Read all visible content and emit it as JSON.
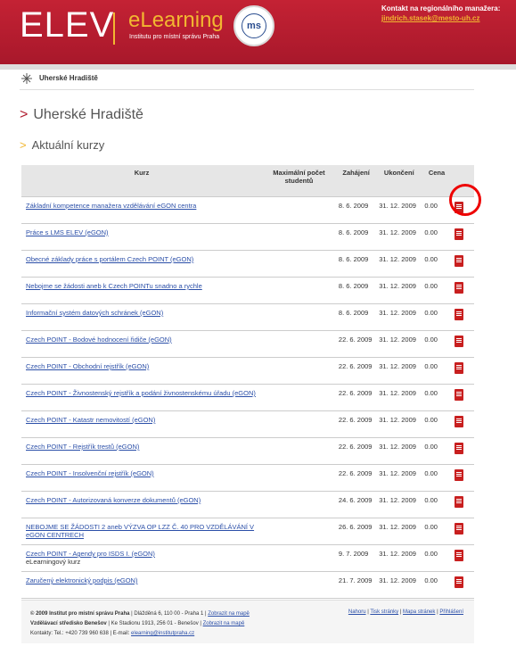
{
  "header": {
    "brand": "ELEV",
    "product": "eLearning",
    "subtitle": "Institutu pro místní správu Praha",
    "contact_label": "Kontakt na regionálního manažera:",
    "contact_email": "jindrich.stasek@mesto-uh.cz"
  },
  "breadcrumb": {
    "label": "Uherské Hradiště"
  },
  "page": {
    "title": "Uherské Hradiště",
    "section": "Aktuální kurzy"
  },
  "table": {
    "headers": {
      "course": "Kurz",
      "max": "Maximální počet studentů",
      "start": "Zahájení",
      "end": "Ukončení",
      "price": "Cena"
    },
    "rows": [
      {
        "name": "Základní kompetence manažera vzdělávání eGON centra",
        "note": "",
        "start": "8. 6. 2009",
        "end": "31. 12. 2009",
        "price": "0.00"
      },
      {
        "name": "Práce s LMS ELEV (eGON)",
        "note": "",
        "start": "8. 6. 2009",
        "end": "31. 12. 2009",
        "price": "0.00"
      },
      {
        "name": "Obecné základy práce s portálem Czech POINT (eGON)",
        "note": "",
        "start": "8. 6. 2009",
        "end": "31. 12. 2009",
        "price": "0.00"
      },
      {
        "name": "Nebojme se žádosti aneb k Czech POINTu snadno a rychle",
        "note": "",
        "start": "8. 6. 2009",
        "end": "31. 12. 2009",
        "price": "0.00"
      },
      {
        "name": "Informační systém datových schránek (eGON)",
        "note": "",
        "start": "8. 6. 2009",
        "end": "31. 12. 2009",
        "price": "0.00"
      },
      {
        "name": "Czech POINT - Bodové hodnocení řidiče (eGON)",
        "note": "",
        "start": "22. 6. 2009",
        "end": "31. 12. 2009",
        "price": "0.00"
      },
      {
        "name": "Czech POINT - Obchodní rejstřík (eGON)",
        "note": "",
        "start": "22. 6. 2009",
        "end": "31. 12. 2009",
        "price": "0.00"
      },
      {
        "name": "Czech POINT - Živnostenský rejstřík a podání živnostenskému úřadu (eGON)",
        "note": "",
        "start": "22. 6. 2009",
        "end": "31. 12. 2009",
        "price": "0.00"
      },
      {
        "name": "Czech POINT - Katastr nemovitostí (eGON)",
        "note": "",
        "start": "22. 6. 2009",
        "end": "31. 12. 2009",
        "price": "0.00"
      },
      {
        "name": "Czech POINT - Rejstřík trestů (eGON)",
        "note": "",
        "start": "22. 6. 2009",
        "end": "31. 12. 2009",
        "price": "0.00"
      },
      {
        "name": "Czech POINT - Insolvenční rejstřík (eGON)",
        "note": "",
        "start": "22. 6. 2009",
        "end": "31. 12. 2009",
        "price": "0.00"
      },
      {
        "name": "Czech POINT - Autorizovaná konverze dokumentů (eGON)",
        "note": "",
        "start": "24. 6. 2009",
        "end": "31. 12. 2009",
        "price": "0.00"
      },
      {
        "name": "NEBOJME SE ŽÁDOSTI 2 aneb VÝZVA OP LZZ Č. 40 PRO VZDĚLÁVÁNÍ V eGON CENTRECH",
        "note": "",
        "start": "26. 6. 2009",
        "end": "31. 12. 2009",
        "price": "0.00"
      },
      {
        "name": "Czech POINT - Agendy pro ISDS I. (eGON)",
        "note": "eLearningový kurz",
        "start": "9. 7. 2009",
        "end": "31. 12. 2009",
        "price": "0.00"
      },
      {
        "name": "Zaručený elektronický podpis (eGON)",
        "note": "",
        "start": "21. 7. 2009",
        "end": "31. 12. 2009",
        "price": "0.00"
      }
    ]
  },
  "footer": {
    "copyright": "© 2009 Institut pro místní správu Praha",
    "address1": "| Dlážděná 6, 110 00 - Praha 1 |",
    "map_link": "Zobrazit na mapě",
    "center": "Vzdělávací středisko Benešov",
    "address2": "| Ke Stadionu 1913, 256 01 - Benešov |",
    "contacts": "Kontakty: Tel.: +420 739 960 638 | E-mail:",
    "email": "elearning@institutpraha.cz",
    "links": [
      "Nahoru",
      "Tisk stránky",
      "Mapa stránek",
      "Přihlášení"
    ]
  }
}
